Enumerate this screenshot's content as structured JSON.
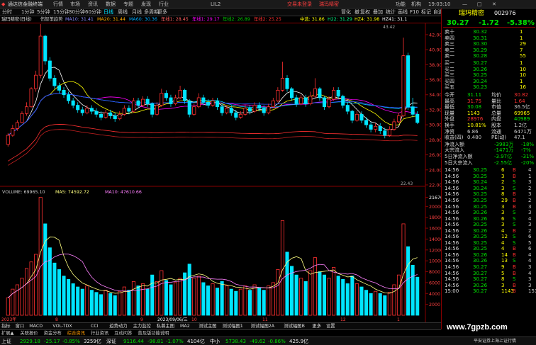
{
  "window": {
    "app_title": "通达信金融终端",
    "menus": [
      "行情",
      "市场",
      "资讯",
      "数据",
      "专题",
      "发现",
      "行业",
      "",
      "LIL2"
    ],
    "notice": "交易未登录",
    "notice2": "瑞玛精密",
    "right_menus": [
      "功能",
      "机构",
      "19:03:10",
      "[最小化]"
    ]
  },
  "toolbar": {
    "periods": [
      "分时",
      "1分钟",
      "5分钟",
      "15分钟",
      "30分钟",
      "60分钟",
      "日线",
      "周线",
      "月线",
      "多周期",
      "更多"
    ],
    "right": [
      "冒化",
      "撤",
      "复权",
      "叠加",
      "统计",
      "画线",
      "F10",
      "标记",
      "-",
      "自选",
      "返回"
    ]
  },
  "infobar": {
    "items": [
      "瑞玛精密(日线)",
      "伤智策趋势",
      "MA10: 31.41",
      "MA20: 31.44",
      "MA60: 30.36",
      "年线1: 28.45",
      "年线1: 29.17",
      "年线2: 26.89",
      "年线2: 25.25",
      "中选: 31.86",
      "H22: 31.29",
      "HZ4: 31.98",
      "HZ41: 31.1"
    ]
  },
  "price_axis": [
    "42.00",
    "40.00",
    "38.00",
    "36.00",
    "34.00",
    "32.00",
    "30.00",
    "28.00",
    "26.00",
    "24.00",
    "22.00"
  ],
  "price_labels": {
    "high": "43.42",
    "low": "22.43"
  },
  "volume_header": {
    "title": "VOLUME",
    "vol": "69965.10",
    "ma5_label": "MA5",
    "ma5": "74592.72",
    "ma10_label": "MA10",
    "ma10": "47610.66"
  },
  "volume_axis": [
    "21670",
    "20000",
    "18000",
    "16000",
    "14000",
    "12000",
    "10000",
    "8000",
    "6000",
    "4000",
    "2000"
  ],
  "x_labels": [
    "2023年",
    "8",
    "9",
    "2023/09/06/三",
    "10",
    "11",
    "12",
    "1"
  ],
  "quote": {
    "name": "瑞玛精密",
    "code": "002976",
    "price": "30.27",
    "change": "-1.72",
    "pct": "-5.38%",
    "asks": [
      [
        "卖十",
        "30.32",
        "1"
      ],
      [
        "卖四",
        "30.31",
        "1"
      ],
      [
        "卖三",
        "30.30",
        "29"
      ],
      [
        "卖二",
        "30.29",
        "7"
      ],
      [
        "卖一",
        "30.28",
        "55"
      ]
    ],
    "bids": [
      [
        "买一",
        "30.27",
        "1"
      ],
      [
        "买二",
        "30.26",
        "10"
      ],
      [
        "买三",
        "30.25",
        "10"
      ],
      [
        "买四",
        "30.24",
        "1"
      ],
      [
        "买五",
        "30.23",
        "16"
      ]
    ],
    "stats": [
      [
        "今开",
        "31.11",
        "均价",
        "30.82"
      ],
      [
        "最高",
        "31.75",
        "量比",
        "1.64"
      ],
      [
        "最低",
        "30.08",
        "市值",
        "36.5亿"
      ],
      [
        "现量",
        "1143",
        "总量",
        "69965"
      ],
      [
        "外盘",
        "28976",
        "内盘",
        "40989"
      ],
      [
        "换手",
        "10.81%",
        "股本",
        "1.2亿"
      ],
      [
        "净资",
        "6.86",
        "流通",
        "6471万"
      ],
      [
        "收益(四)",
        "0.480",
        "PE(动)",
        "47.1"
      ]
    ],
    "flows": [
      [
        "净流入额",
        "-3983万",
        "-18%"
      ],
      [
        "大宗流入",
        "-1471万",
        "-7%"
      ],
      [
        "5日净流入额",
        "-3.97亿",
        "-31%"
      ],
      [
        "5日大宗流入",
        "-2.55亿",
        "-20%"
      ]
    ],
    "ticks": [
      [
        "14:56",
        "30.25",
        "6",
        "B",
        "4"
      ],
      [
        "14:56",
        "30.25",
        "3",
        "B",
        "1"
      ],
      [
        "14:56",
        "30.24",
        "2",
        "S",
        "3"
      ],
      [
        "14:56",
        "30.24",
        "3",
        "S",
        "2"
      ],
      [
        "14:56",
        "30.25",
        "8",
        "B",
        "3"
      ],
      [
        "14:56",
        "30.25",
        "29",
        "B",
        "2"
      ],
      [
        "14:56",
        "30.25",
        "3",
        "B",
        "3"
      ],
      [
        "14:56",
        "30.26",
        "3",
        "S",
        "3"
      ],
      [
        "14:56",
        "30.26",
        "6",
        "S",
        "4"
      ],
      [
        "14:56",
        "30.25",
        "3",
        "S",
        "3"
      ],
      [
        "14:56",
        "30.26",
        "4",
        "B",
        "2"
      ],
      [
        "14:56",
        "30.25",
        "12",
        "S",
        "6"
      ],
      [
        "14:56",
        "30.25",
        "4",
        "S",
        "5"
      ],
      [
        "14:56",
        "30.25",
        "4",
        "B",
        "6"
      ],
      [
        "14:56",
        "30.26",
        "14",
        "B",
        "4"
      ],
      [
        "14:56",
        "30.26",
        "13",
        "S",
        "4"
      ],
      [
        "14:56",
        "30.27",
        "9",
        "B",
        "3"
      ],
      [
        "14:56",
        "30.27",
        "5",
        "B",
        "4"
      ],
      [
        "14:56",
        "30.27",
        "8",
        "S",
        "3"
      ],
      [
        "14:56",
        "30.26",
        "3",
        "B",
        "3"
      ],
      [
        "15:00",
        "30.27",
        "1143",
        "B",
        "151"
      ]
    ]
  },
  "bottom_tabs": [
    "指标",
    "窗口",
    "MACD",
    "VOL-TDX",
    "CCI",
    "趋势动力",
    "主力监控",
    "私募主图",
    "MA2",
    "测试主图",
    "测试幅图1",
    "测试幅图2A",
    "测试幅图B",
    "更多",
    "设置"
  ],
  "bottom_tabs2": [
    "扩展▲",
    "关联报价",
    "资金分布",
    "综合资讯",
    "行业资讯",
    "互动问答",
    "普及版功能说明"
  ],
  "status": {
    "sh_label": "上证",
    "sh": "2929.18",
    "sh_chg": "-25.17",
    "sh_pct": "-0.85%",
    "sh_amt": "3259亿",
    "sz_label": "深证",
    "sz": "9116.44",
    "sz_chg": "-98.81",
    "sz_pct": "-1.07%",
    "sz_amt": "4104亿",
    "cy_label": "中小",
    "cy": "5738.43",
    "cy_chg": "-49.62",
    "cy_pct": "-0.86%",
    "cy_amt": "425.9亿",
    "right": "平安证券上海上证行情"
  },
  "watermark": "www.7gpzb.com",
  "chart_data": {
    "type": "candlestick",
    "series_note": "",
    "candles": [
      [
        27.4,
        28.6,
        27.1,
        28.9,
        1
      ],
      [
        28.6,
        29.5,
        28.4,
        30.0,
        1
      ],
      [
        29.5,
        30.3,
        29.2,
        30.6,
        1
      ],
      [
        30.3,
        31.5,
        30.2,
        31.8,
        1
      ],
      [
        31.5,
        32.4,
        31.2,
        33.0,
        1
      ],
      [
        32.4,
        34.8,
        32.3,
        35.0,
        1
      ],
      [
        34.8,
        36.6,
        34.4,
        37.2,
        1
      ],
      [
        36.6,
        41.8,
        36.2,
        43.4,
        1
      ],
      [
        41.8,
        38.5,
        38.0,
        42.0,
        0
      ],
      [
        38.5,
        36.2,
        35.8,
        39.0,
        0
      ],
      [
        36.2,
        35.2,
        34.8,
        36.6,
        0
      ],
      [
        35.2,
        34.6,
        34.2,
        35.6,
        0
      ],
      [
        34.6,
        34.0,
        33.6,
        35.0,
        0
      ],
      [
        34.0,
        33.2,
        32.8,
        34.4,
        0
      ],
      [
        33.2,
        32.6,
        32.2,
        33.6,
        0
      ],
      [
        32.6,
        32.0,
        31.6,
        33.0,
        0
      ],
      [
        32.0,
        31.6,
        31.2,
        32.4,
        0
      ],
      [
        31.6,
        32.2,
        31.4,
        32.6,
        1
      ],
      [
        32.2,
        31.8,
        31.4,
        32.6,
        0
      ],
      [
        31.8,
        31.4,
        31.0,
        32.2,
        0
      ],
      [
        31.4,
        31.0,
        30.6,
        31.8,
        0
      ],
      [
        31.0,
        31.6,
        30.8,
        32.0,
        1
      ],
      [
        31.6,
        31.2,
        30.8,
        32.0,
        0
      ],
      [
        31.2,
        30.8,
        30.4,
        31.6,
        0
      ],
      [
        30.8,
        31.4,
        30.6,
        31.8,
        1
      ],
      [
        31.4,
        32.2,
        31.2,
        32.6,
        1
      ],
      [
        32.2,
        31.8,
        31.4,
        32.6,
        0
      ],
      [
        31.8,
        33.2,
        31.6,
        33.6,
        1
      ],
      [
        33.2,
        32.6,
        32.2,
        33.6,
        0
      ],
      [
        32.6,
        33.4,
        32.4,
        33.8,
        1
      ],
      [
        33.4,
        32.8,
        32.4,
        33.8,
        0
      ],
      [
        32.8,
        31.4,
        31.0,
        33.0,
        0
      ],
      [
        31.4,
        32.6,
        31.2,
        33.0,
        1
      ],
      [
        32.6,
        34.2,
        32.4,
        34.8,
        1
      ],
      [
        34.2,
        33.6,
        33.2,
        34.6,
        0
      ],
      [
        33.6,
        32.8,
        32.4,
        34.0,
        0
      ],
      [
        32.8,
        33.6,
        32.6,
        34.0,
        1
      ],
      [
        33.6,
        34.6,
        33.4,
        35.2,
        1
      ],
      [
        34.6,
        33.2,
        32.8,
        34.8,
        0
      ],
      [
        33.2,
        31.4,
        31.0,
        33.4,
        0
      ],
      [
        31.4,
        32.4,
        31.2,
        32.8,
        1
      ],
      [
        32.4,
        33.6,
        32.2,
        34.2,
        1
      ],
      [
        33.6,
        33.0,
        32.6,
        34.0,
        0
      ],
      [
        33.0,
        32.6,
        32.2,
        33.4,
        0
      ],
      [
        32.6,
        33.2,
        32.4,
        33.6,
        1
      ],
      [
        33.2,
        32.4,
        32.0,
        33.6,
        0
      ],
      [
        32.4,
        31.6,
        31.2,
        32.8,
        0
      ],
      [
        31.6,
        32.2,
        31.4,
        32.6,
        1
      ],
      [
        32.2,
        31.6,
        31.2,
        32.6,
        0
      ],
      [
        31.6,
        31.0,
        30.6,
        32.0,
        0
      ],
      [
        31.0,
        31.4,
        30.8,
        31.8,
        1
      ],
      [
        31.4,
        32.2,
        31.2,
        32.6,
        1
      ],
      [
        32.2,
        31.8,
        31.4,
        32.6,
        0
      ],
      [
        31.8,
        32.6,
        31.6,
        33.0,
        1
      ],
      [
        32.6,
        32.2,
        31.8,
        33.0,
        0
      ],
      [
        32.2,
        31.6,
        31.2,
        32.6,
        0
      ],
      [
        31.6,
        32.4,
        31.4,
        32.8,
        1
      ],
      [
        32.4,
        33.2,
        32.2,
        33.6,
        1
      ],
      [
        33.2,
        34.6,
        33.0,
        35.0,
        1
      ],
      [
        34.6,
        36.2,
        34.4,
        38.4,
        1
      ],
      [
        36.2,
        34.8,
        34.4,
        36.6,
        0
      ],
      [
        34.8,
        33.6,
        33.2,
        35.0,
        0
      ],
      [
        33.6,
        32.8,
        32.4,
        34.0,
        0
      ],
      [
        32.8,
        33.6,
        32.6,
        34.0,
        1
      ],
      [
        33.6,
        32.8,
        32.4,
        34.0,
        0
      ],
      [
        32.8,
        33.8,
        32.6,
        34.4,
        1
      ],
      [
        33.8,
        34.8,
        33.6,
        36.2,
        1
      ],
      [
        34.8,
        33.6,
        33.2,
        35.0,
        0
      ],
      [
        33.6,
        32.4,
        32.0,
        33.8,
        0
      ],
      [
        32.4,
        33.4,
        32.2,
        33.8,
        1
      ],
      [
        33.4,
        34.6,
        33.2,
        35.0,
        1
      ],
      [
        34.6,
        33.8,
        33.4,
        35.0,
        0
      ],
      [
        33.8,
        32.6,
        32.2,
        34.0,
        0
      ],
      [
        32.6,
        31.8,
        31.4,
        33.0,
        0
      ],
      [
        31.8,
        30.6,
        30.2,
        32.0,
        0
      ],
      [
        30.6,
        31.4,
        30.4,
        31.8,
        1
      ],
      [
        31.4,
        30.6,
        30.2,
        31.8,
        0
      ],
      [
        30.6,
        30.0,
        29.6,
        31.0,
        0
      ],
      [
        30.0,
        29.4,
        29.0,
        30.4,
        0
      ],
      [
        29.4,
        29.8,
        29.0,
        30.2,
        1
      ],
      [
        29.8,
        29.2,
        28.8,
        30.2,
        0
      ],
      [
        29.2,
        28.6,
        28.2,
        29.6,
        0
      ],
      [
        28.6,
        29.4,
        28.4,
        29.8,
        1
      ],
      [
        29.4,
        30.4,
        29.2,
        30.8,
        1
      ],
      [
        30.4,
        31.2,
        30.2,
        31.6,
        1
      ],
      [
        31.2,
        39.2,
        31.0,
        41.6,
        1
      ],
      [
        39.2,
        32.4,
        32.0,
        39.6,
        0
      ],
      [
        32.4,
        31.4,
        31.0,
        33.6,
        0
      ],
      [
        31.4,
        30.3,
        30.1,
        31.8,
        0
      ]
    ],
    "volume": [
      3200,
      4800,
      5600,
      6800,
      8600,
      9800,
      11200,
      21670,
      16800,
      12400,
      9600,
      8400,
      7200,
      6600,
      5800,
      5200,
      4800,
      5400,
      4600,
      4200,
      3800,
      4600,
      4000,
      3600,
      4400,
      5200,
      4600,
      6200,
      5400,
      5800,
      4800,
      7400,
      6200,
      8200,
      6400,
      5600,
      6000,
      6800,
      7800,
      9400,
      6800,
      7200,
      6000,
      5400,
      5800,
      5000,
      6200,
      5400,
      4800,
      4400,
      4800,
      5400,
      4600,
      5600,
      5000,
      4600,
      5400,
      6000,
      8400,
      17400,
      11600,
      9000,
      7400,
      6800,
      6200,
      8200,
      10600,
      8000,
      7400,
      6800,
      8800,
      7200,
      6600,
      5800,
      7200,
      5800,
      5200,
      4600,
      4000,
      4400,
      4000,
      3600,
      4200,
      5600,
      7400,
      16800,
      12600,
      9200,
      6996
    ]
  }
}
